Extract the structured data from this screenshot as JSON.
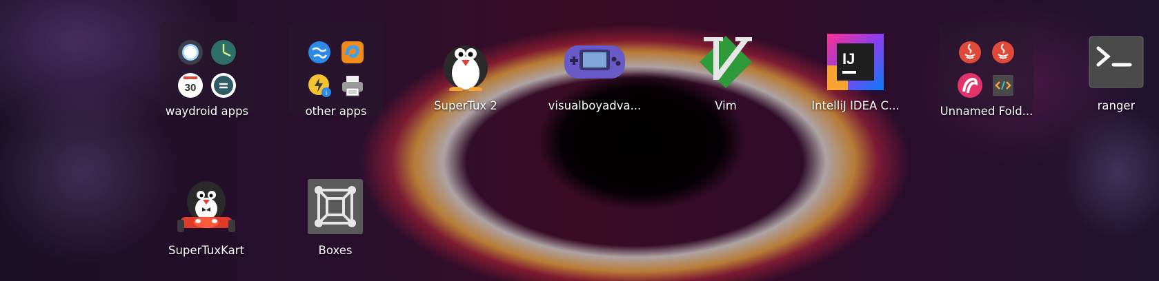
{
  "launcher": {
    "row1": [
      {
        "label": "waydroid apps",
        "type": "folder",
        "icons": [
          "waydroid-bubble-icon",
          "clock-icon",
          "calendar-icon",
          "notes-icon"
        ],
        "calendar_day": "30"
      },
      {
        "label": "other apps",
        "type": "folder",
        "icons": [
          "globe-icon",
          "swirl-icon",
          "power-info-icon",
          "printer-icon"
        ]
      },
      {
        "label": "SuperTux 2",
        "type": "app",
        "icon": "penguin-icon"
      },
      {
        "label": "visualboyadva...",
        "type": "app",
        "icon": "gameboy-advance-icon"
      },
      {
        "label": "Vim",
        "type": "app",
        "icon": "vim-icon"
      },
      {
        "label": "IntelliJ IDEA C...",
        "type": "app",
        "icon": "intellij-icon",
        "icon_text": "IJ"
      },
      {
        "label": "Unnamed Fold...",
        "type": "folder",
        "icons": [
          "java-icon",
          "java-icon",
          "flamingo-icon",
          "code-icon"
        ]
      },
      {
        "label": "ranger",
        "type": "app",
        "icon": "terminal-icon"
      }
    ],
    "row2": [
      {
        "label": "SuperTuxKart",
        "type": "app",
        "icon": "kart-penguin-icon"
      },
      {
        "label": "Boxes",
        "type": "app",
        "icon": "boxes-icon"
      }
    ]
  },
  "colors": {
    "label_text": "#ffffff",
    "vim_green": "#2e9a3a",
    "intellij_dark": "#1e1e1e",
    "java_red": "#e04a3a",
    "boxes_gray": "#5a5a5a"
  }
}
